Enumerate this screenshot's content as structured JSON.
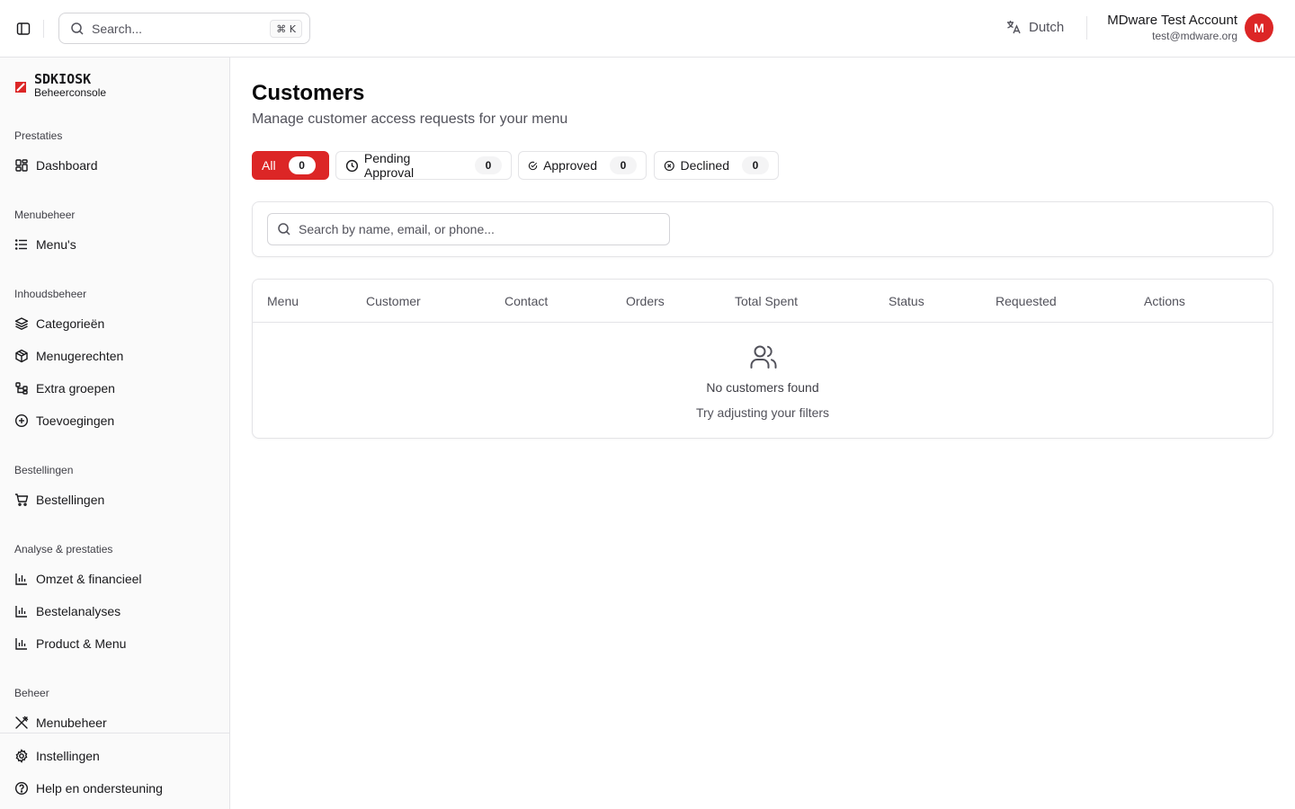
{
  "topbar": {
    "search_placeholder": "Search...",
    "search_shortcut": "⌘ K",
    "language": "Dutch",
    "account_name": "MDware Test Account",
    "account_email": "test@mdware.org",
    "avatar_initial": "M"
  },
  "brand": {
    "wordmark": "SDKIOSK",
    "subtitle": "Beheerconsole",
    "accent_color": "#dc2626"
  },
  "sidebar": {
    "sections": [
      {
        "label": "Prestaties",
        "items": [
          {
            "label": "Dashboard",
            "icon": "dashboard-icon"
          }
        ]
      },
      {
        "label": "Menubeheer",
        "items": [
          {
            "label": "Menu's",
            "icon": "list-icon"
          }
        ]
      },
      {
        "label": "Inhoudsbeheer",
        "items": [
          {
            "label": "Categorieën",
            "icon": "layers-icon"
          },
          {
            "label": "Menugerechten",
            "icon": "package-icon"
          },
          {
            "label": "Extra groepen",
            "icon": "groups-icon"
          },
          {
            "label": "Toevoegingen",
            "icon": "plus-circle-icon"
          }
        ]
      },
      {
        "label": "Bestellingen",
        "items": [
          {
            "label": "Bestellingen",
            "icon": "cart-icon"
          }
        ]
      },
      {
        "label": "Analyse & prestaties",
        "items": [
          {
            "label": "Omzet & financieel",
            "icon": "bar-chart-icon"
          },
          {
            "label": "Bestelanalyses",
            "icon": "bar-chart-icon"
          },
          {
            "label": "Product & Menu",
            "icon": "bar-chart-icon"
          }
        ]
      },
      {
        "label": "Beheer",
        "items": [
          {
            "label": "Menubeheer",
            "icon": "utensils-icon"
          }
        ]
      }
    ],
    "footer": [
      {
        "label": "Instellingen",
        "icon": "gear-icon"
      },
      {
        "label": "Help en ondersteuning",
        "icon": "help-icon"
      }
    ]
  },
  "main": {
    "title": "Customers",
    "subtitle": "Manage customer access requests for your menu",
    "filters": [
      {
        "label": "All",
        "count": "0",
        "active": true
      },
      {
        "label": "Pending Approval",
        "count": "0",
        "icon": "clock-icon"
      },
      {
        "label": "Approved",
        "count": "0",
        "icon": "check-circle-icon"
      },
      {
        "label": "Declined",
        "count": "0",
        "icon": "x-circle-icon"
      }
    ],
    "search_placeholder": "Search by name, email, or phone...",
    "table": {
      "columns": [
        "Menu",
        "Customer",
        "Contact",
        "Orders",
        "Total Spent",
        "Status",
        "Requested",
        "Actions"
      ],
      "empty_title": "No customers found",
      "empty_hint": "Try adjusting your filters"
    }
  }
}
